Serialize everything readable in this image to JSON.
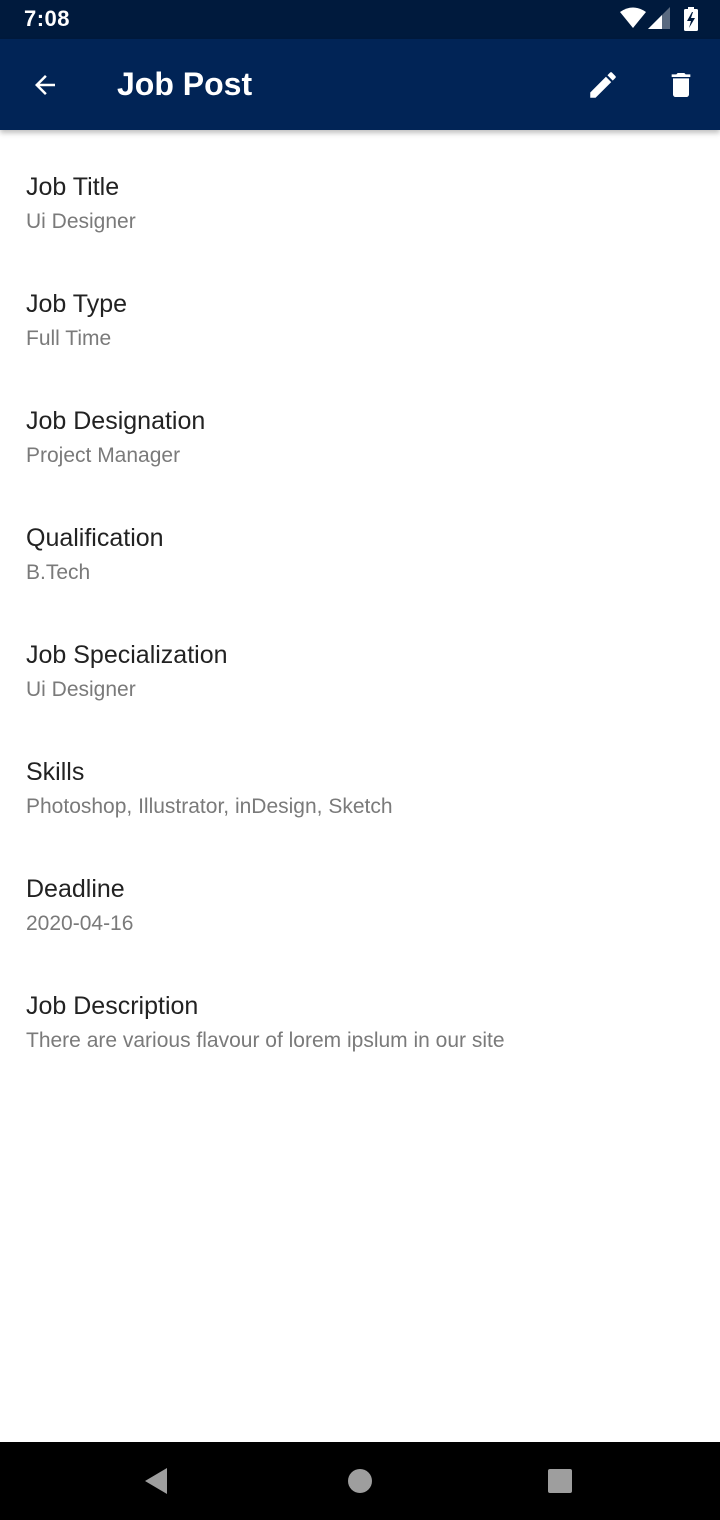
{
  "status_bar": {
    "time": "7:08",
    "icons": [
      "wifi-icon",
      "cell-signal-icon",
      "battery-charging-icon"
    ]
  },
  "app_bar": {
    "title": "Job Post",
    "background_color": "#012456",
    "icons": {
      "back": "arrow-back-icon",
      "edit": "pencil-icon",
      "delete": "trash-icon"
    }
  },
  "fields": [
    {
      "label": "Job Title",
      "value": "Ui Designer"
    },
    {
      "label": "Job Type",
      "value": "Full Time"
    },
    {
      "label": "Job Designation",
      "value": "Project Manager"
    },
    {
      "label": "Qualification",
      "value": "B.Tech"
    },
    {
      "label": "Job Specialization",
      "value": "Ui Designer"
    },
    {
      "label": "Skills",
      "value": "Photoshop, Illustrator, inDesign, Sketch"
    },
    {
      "label": "Deadline",
      "value": "2020-04-16"
    },
    {
      "label": "Job Description",
      "value": "There are various flavour of lorem ipslum in our site"
    }
  ],
  "nav_bar": {
    "icons": [
      "nav-back-triangle-icon",
      "nav-home-circle-icon",
      "nav-recents-square-icon"
    ]
  }
}
